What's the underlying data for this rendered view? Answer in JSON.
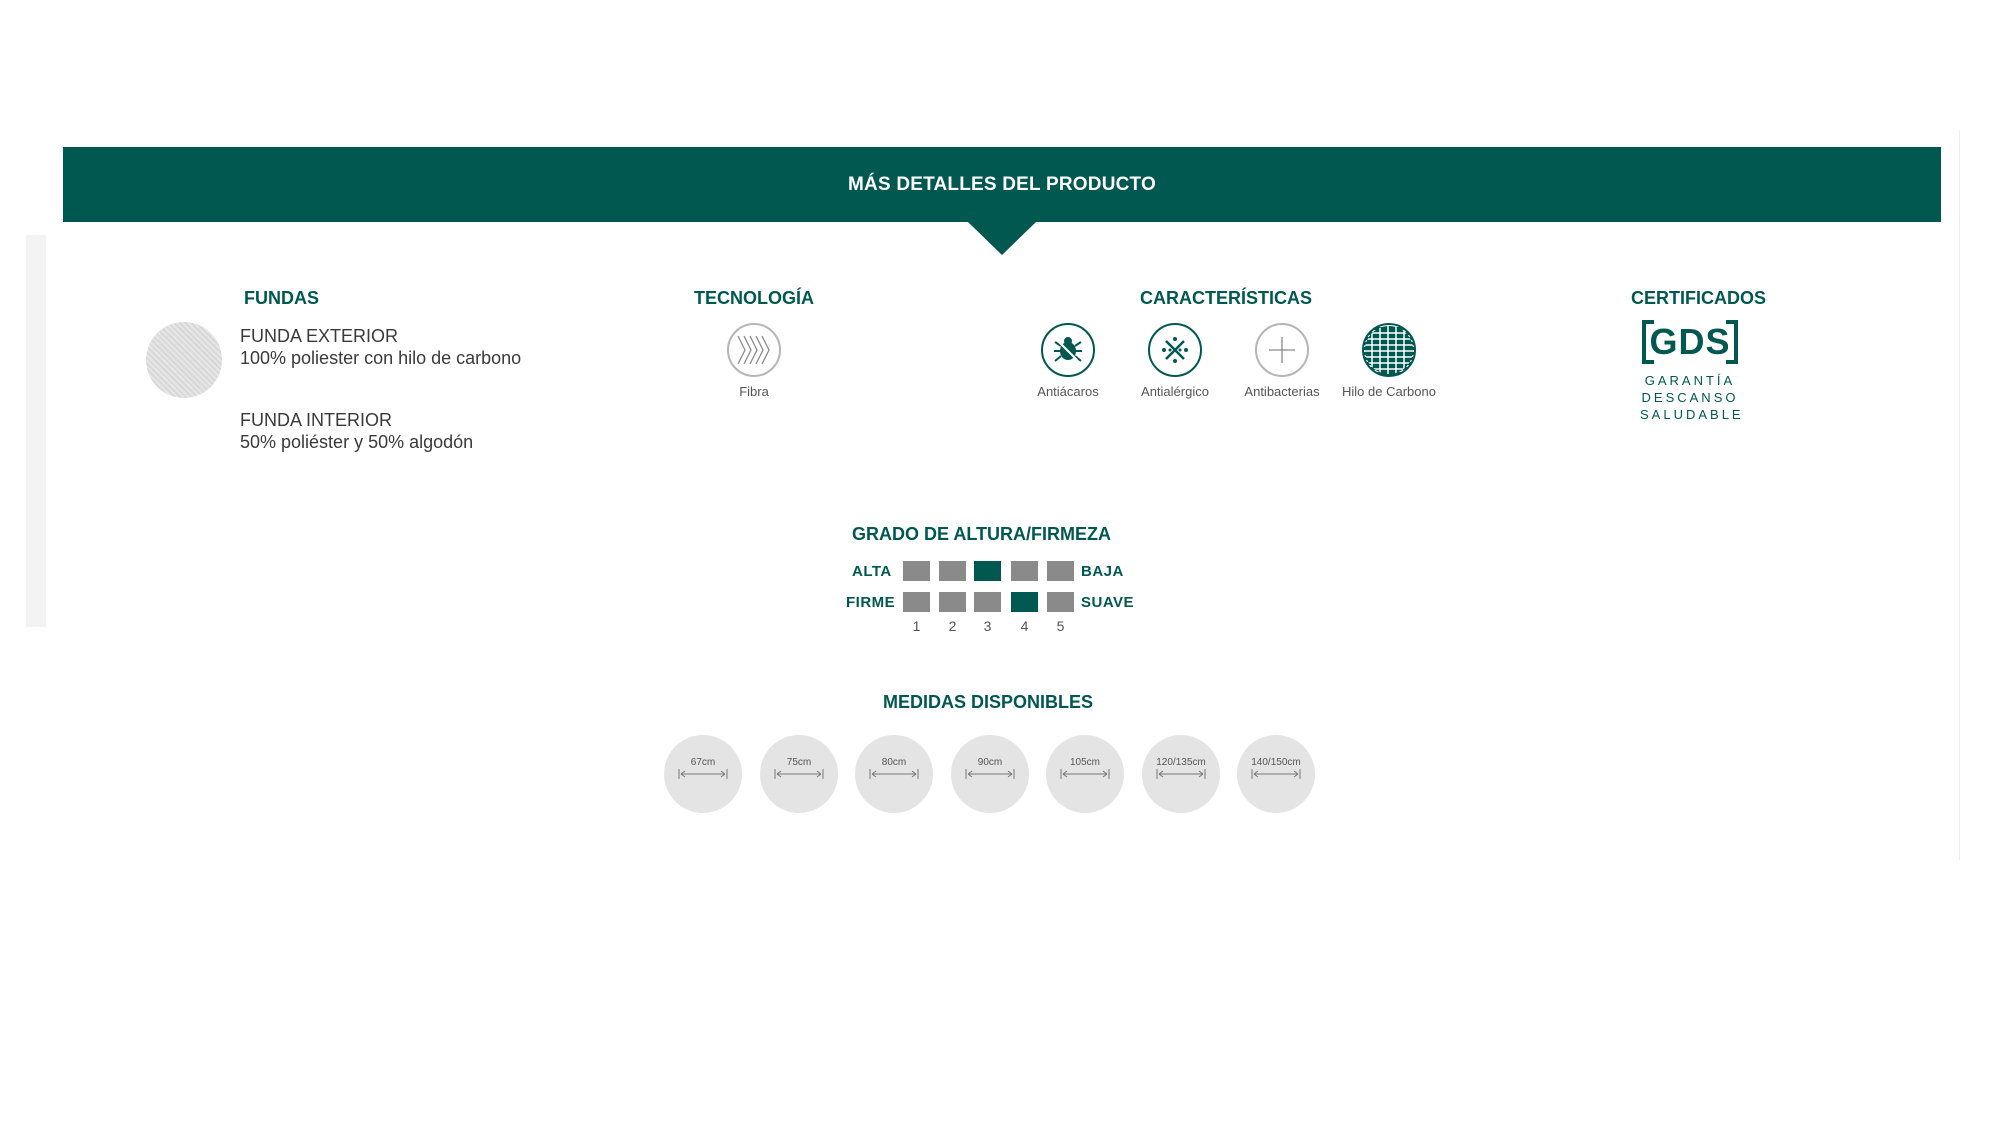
{
  "banner": {
    "title": "MÁS DETALLES DEL PRODUCTO"
  },
  "fundas": {
    "heading": "FUNDAS",
    "exterior": {
      "title": "FUNDA EXTERIOR",
      "desc": "100% poliester con hilo de carbono"
    },
    "interior": {
      "title": "FUNDA INTERIOR",
      "desc": "50% poliéster y 50% algodón"
    }
  },
  "tecnologia": {
    "heading": "TECNOLOGÍA",
    "items": [
      {
        "label": "Fibra",
        "icon": "fiber-chevron-icon"
      }
    ]
  },
  "caracteristicas": {
    "heading": "CARACTERÍSTICAS",
    "items": [
      {
        "label": "Antiácaros",
        "icon": "anti-mite-icon"
      },
      {
        "label": "Antialérgico",
        "icon": "anti-allergy-icon"
      },
      {
        "label": "Antibacterias",
        "icon": "antibacterial-cross-icon"
      },
      {
        "label": "Hilo de Carbono",
        "icon": "carbon-thread-grid-icon"
      }
    ]
  },
  "certificados": {
    "heading": "CERTIFICADOS",
    "logo": {
      "text": "GDS",
      "line1": "GARANTÍA",
      "line2": "DESCANSO",
      "line3": "SALUDABLE"
    }
  },
  "firmeza": {
    "heading": "GRADO DE ALTURA/FIRMEZA",
    "altura": {
      "left": "ALTA",
      "right": "BAJA",
      "value": 3
    },
    "firmeza": {
      "left": "FIRME",
      "right": "SUAVE",
      "value": 4
    },
    "scale": [
      "1",
      "2",
      "3",
      "4",
      "5"
    ]
  },
  "medidas": {
    "heading": "MEDIDAS DISPONIBLES",
    "sizes": [
      "67cm",
      "75cm",
      "80cm",
      "90cm",
      "105cm",
      "120/135cm",
      "140/150cm"
    ]
  },
  "colors": {
    "brand": "#005850",
    "inactive": "#8a8a8a",
    "swatch": "#e4e4e4"
  }
}
